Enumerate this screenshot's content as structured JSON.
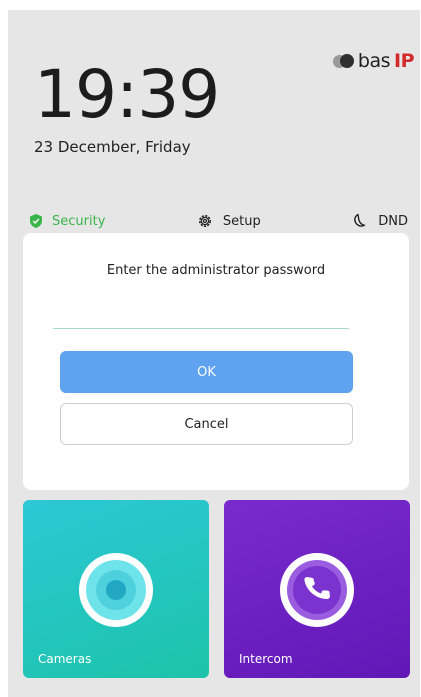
{
  "header": {
    "logo_text": "bas",
    "logo_ip": "IP",
    "time": "19:39",
    "date": "23 December, Friday"
  },
  "status_bar": {
    "security_label": "Security",
    "setup_label": "Setup",
    "dnd_label": "DND"
  },
  "dialog": {
    "title": "Enter the administrator password",
    "password_value": "",
    "ok_label": "OK",
    "cancel_label": "Cancel"
  },
  "tiles": {
    "cameras_label": "Cameras",
    "intercom_label": "Intercom"
  },
  "colors": {
    "security_green": "#3ab54a",
    "ok_blue": "#5fa2f0",
    "cameras_teal": "#1dc3b6",
    "intercom_purple": "#6a1fc0",
    "logo_red": "#d22a2a"
  },
  "icons": {
    "security": "shield-icon",
    "setup": "gear-icon",
    "dnd": "moon-icon",
    "cameras": "camera-lens-icon",
    "intercom": "phone-icon"
  }
}
